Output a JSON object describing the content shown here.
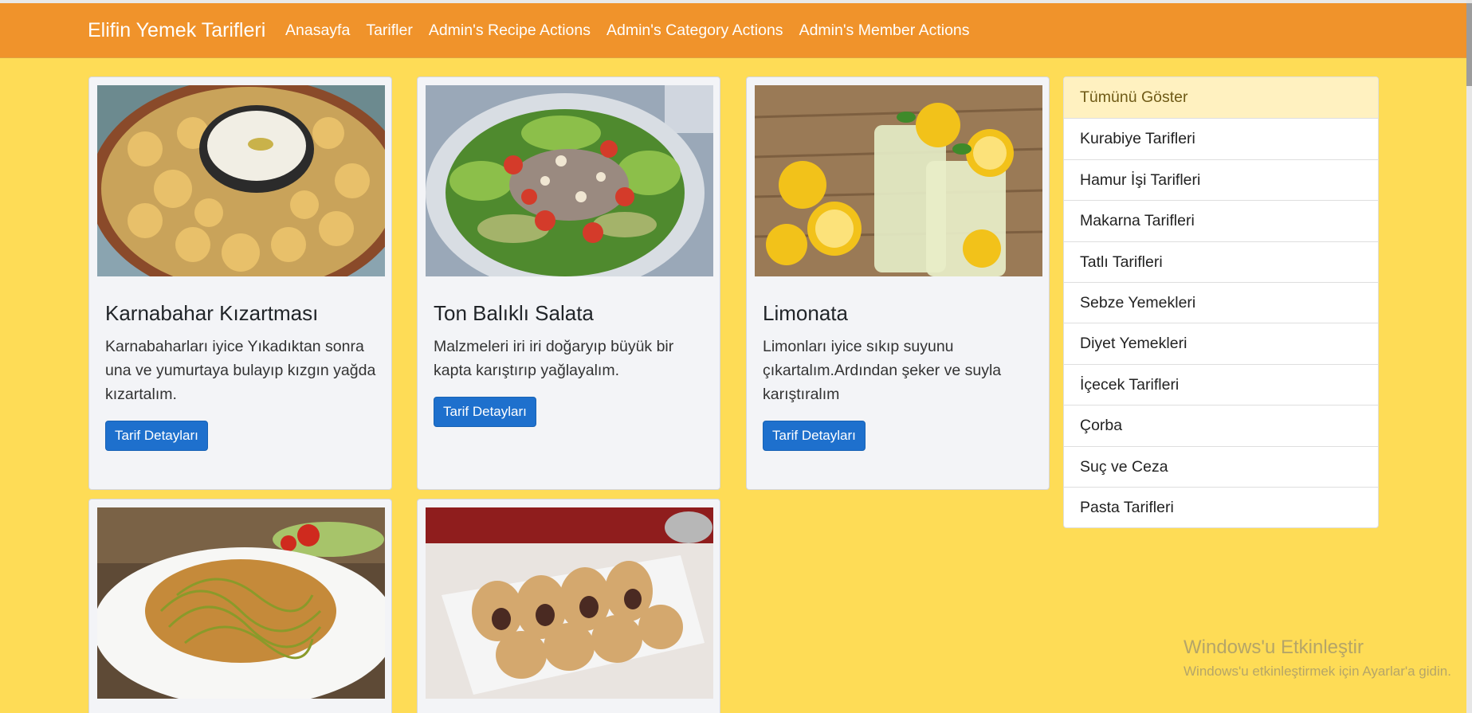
{
  "navbar": {
    "brand": "Elifin Yemek Tarifleri",
    "links": [
      "Anasayfa",
      "Tarifler",
      "Admin's Recipe Actions",
      "Admin's Category Actions",
      "Admin's Member Actions"
    ]
  },
  "recipes": [
    {
      "title": "Karnabahar Kızartması",
      "description": "Karnabaharları iyice Yıkadıktan sonra una ve yumurtaya bulayıp kızgın yağda kızartalım.",
      "button": "Tarif Detayları",
      "image": "fried-cauliflower-photo"
    },
    {
      "title": "Ton Balıklı Salata",
      "description": "Malzmeleri iri iri doğaryıp büyük bir kapta karıştırıp yağlayalım.",
      "button": "Tarif Detayları",
      "image": "tuna-salad-photo"
    },
    {
      "title": "Limonata",
      "description": "Limonları iyice sıkıp suyunu çıkartalım.Ardından şeker ve suyla karıştıralım",
      "button": "Tarif Detayları",
      "image": "lemonade-photo"
    },
    {
      "image": "zucchini-noodles-photo"
    },
    {
      "image": "pastry-rolls-photo"
    }
  ],
  "categories": [
    "Tümünü Göster",
    "Kurabiye Tarifleri",
    "Hamur İşi Tarifleri",
    "Makarna Tarifleri",
    "Tatlı Tarifleri",
    "Sebze Yemekleri",
    "Diyet Yemekleri",
    "İçecek Tarifleri",
    "Çorba",
    "Suç ve Ceza",
    "Pasta Tarifleri"
  ],
  "watermark": {
    "title": "Windows'u Etkinleştir",
    "subtitle": "Windows'u etkinleştirmek için Ayarlar'a gidin."
  },
  "colors": {
    "page_background": "#fedc56",
    "navbar": "#f0932b",
    "card": "#f3f4f7",
    "button": "#1e70cd",
    "active_category": "#fff1c0"
  }
}
